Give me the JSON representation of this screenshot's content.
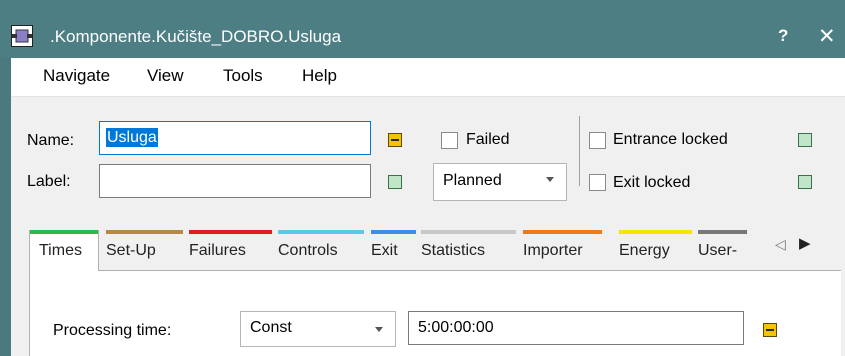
{
  "window": {
    "title": ".Komponente.Kučište_DOBRO.Usluga",
    "help_label": "?",
    "close_label": "✕",
    "icon": "component-icon"
  },
  "menu": [
    "Navigate",
    "View",
    "Tools",
    "Help"
  ],
  "form": {
    "name_label": "Name:",
    "name_value": "Usluga",
    "label_label": "Label:",
    "label_value": "",
    "failed_label": "Failed",
    "failed_checked": false,
    "status_value": "Planned",
    "entrance_locked_label": "Entrance locked",
    "entrance_locked_checked": false,
    "exit_locked_label": "Exit locked",
    "exit_locked_checked": false
  },
  "tabs": [
    {
      "label": "Times",
      "color": "#2db84d",
      "active": true
    },
    {
      "label": "Set-Up",
      "color": "#b58a45"
    },
    {
      "label": "Failures",
      "color": "#e01e1e"
    },
    {
      "label": "Controls",
      "color": "#5bc8e8"
    },
    {
      "label": "Exit",
      "color": "#3d8fe6"
    },
    {
      "label": "Statistics",
      "color": "#c8c8c8"
    },
    {
      "label": "Importer",
      "color": "#ef7a1a"
    },
    {
      "label": "Energy",
      "color": "#f5e600"
    },
    {
      "label": "User-",
      "color": "#777777"
    }
  ],
  "times": {
    "processing_time_label": "Processing time:",
    "distribution_value": "Const",
    "processing_time_value": "5:00:00:00"
  },
  "colors": {
    "titlebar": "#4c7e84",
    "selection": "#0078d7",
    "yellow_button": "#f4c400",
    "green_button": "#bfe6c6"
  }
}
